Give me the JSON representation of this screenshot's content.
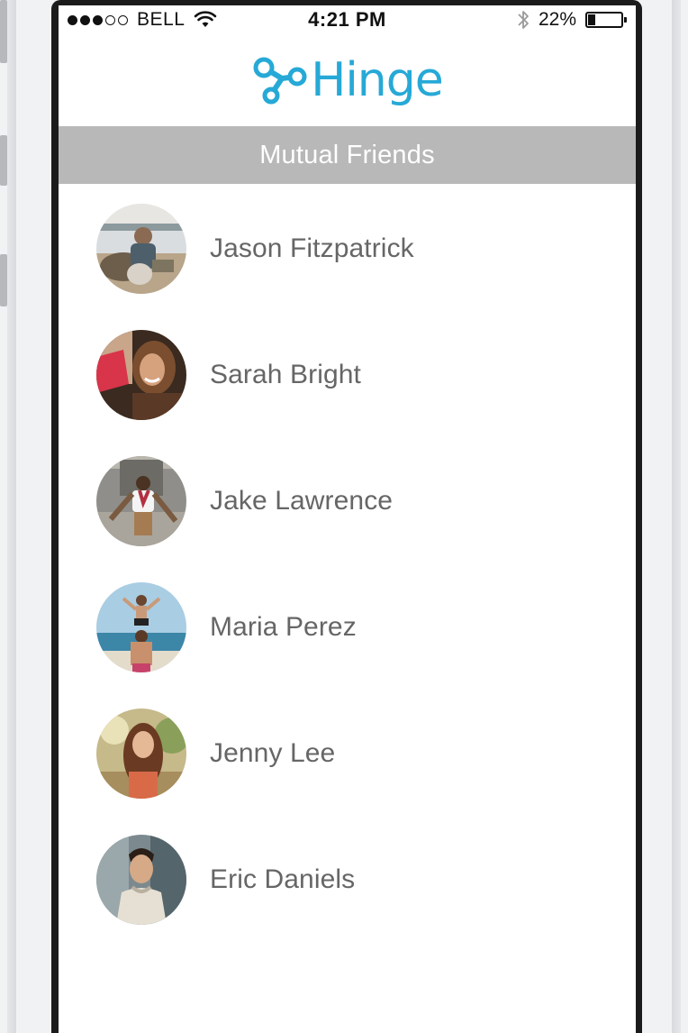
{
  "status_bar": {
    "signal_dots": [
      true,
      true,
      true,
      false,
      false
    ],
    "carrier": "BELL",
    "time": "4:21 PM",
    "battery_percent": "22%",
    "battery_level": 0.22,
    "icons": [
      "wifi-icon",
      "bluetooth-icon",
      "battery-icon"
    ]
  },
  "header": {
    "logo_text": "Hinge",
    "brand_color": "#26a9d6"
  },
  "section": {
    "title": "Mutual Friends",
    "bar_color": "#b8b8b8"
  },
  "friends": [
    {
      "name": "Jason Fitzpatrick"
    },
    {
      "name": "Sarah Bright"
    },
    {
      "name": "Jake Lawrence"
    },
    {
      "name": "Maria Perez"
    },
    {
      "name": "Jenny Lee"
    },
    {
      "name": "Eric Daniels"
    }
  ]
}
